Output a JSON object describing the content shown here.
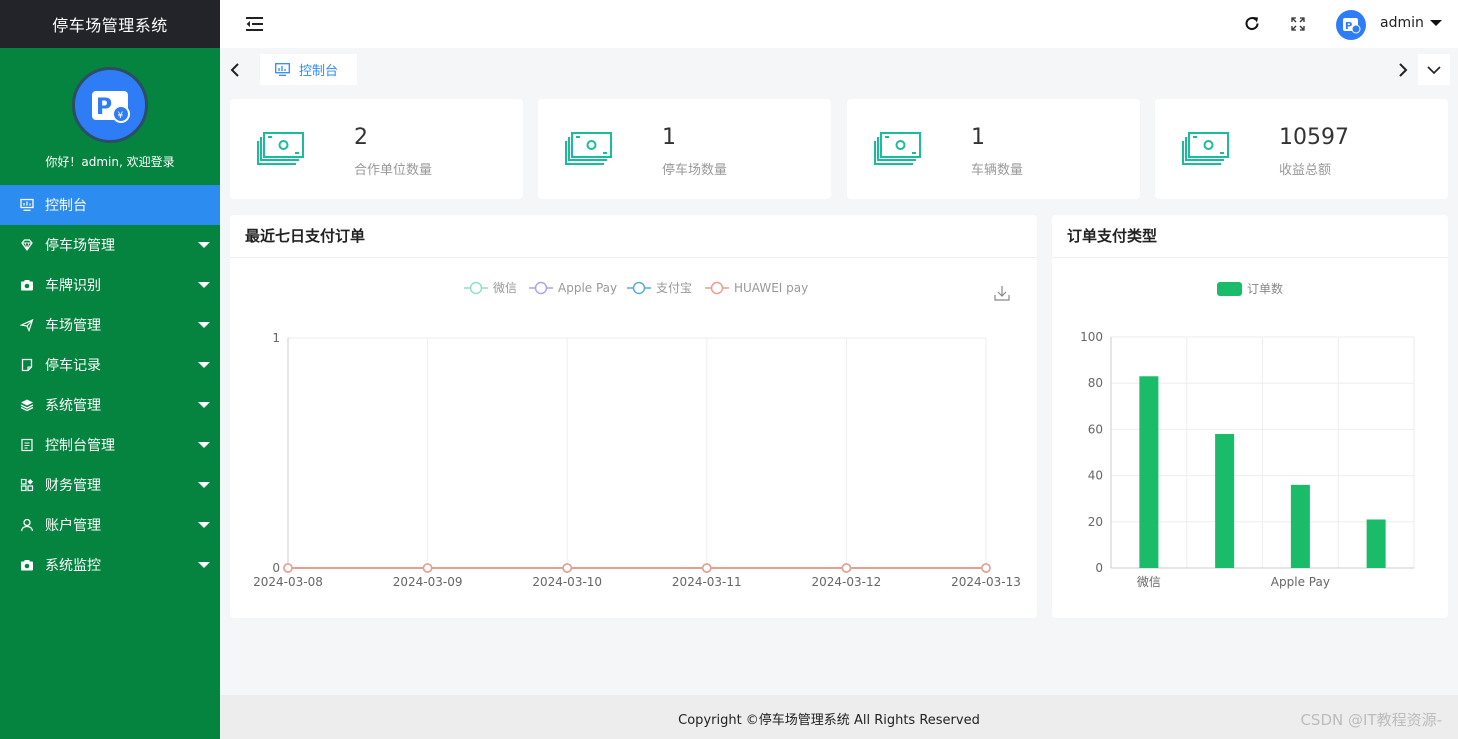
{
  "app": {
    "title": "停车场管理系统"
  },
  "sidebar": {
    "welcome": "你好！admin, 欢迎登录",
    "items": [
      {
        "label": "控制台",
        "icon": "dashboard-icon",
        "active": true,
        "has_children": false
      },
      {
        "label": "停车场管理",
        "icon": "diamond-icon",
        "has_children": true
      },
      {
        "label": "车牌识别",
        "icon": "camera-icon",
        "has_children": true
      },
      {
        "label": "车场管理",
        "icon": "send-icon",
        "has_children": true
      },
      {
        "label": "停车记录",
        "icon": "note-icon",
        "has_children": true
      },
      {
        "label": "系统管理",
        "icon": "layers-icon",
        "has_children": true
      },
      {
        "label": "控制台管理",
        "icon": "clipboard-icon",
        "has_children": true
      },
      {
        "label": "财务管理",
        "icon": "apps-icon",
        "has_children": true
      },
      {
        "label": "账户管理",
        "icon": "user-icon",
        "has_children": true
      },
      {
        "label": "系统监控",
        "icon": "camera-icon",
        "has_children": true
      }
    ]
  },
  "header": {
    "username": "admin"
  },
  "tabs": [
    {
      "label": "控制台",
      "icon": "dashboard-icon"
    }
  ],
  "stats": [
    {
      "value": "2",
      "label": "合作单位数量"
    },
    {
      "value": "1",
      "label": "停车场数量"
    },
    {
      "value": "1",
      "label": "车辆数量"
    },
    {
      "value": "10597",
      "label": "收益总额"
    }
  ],
  "colors": {
    "sidebar": "#05843f",
    "brand_bar": "#222429",
    "active": "#2d8cf0",
    "bar": "#1abc6a",
    "money_icon": "#1abc9c"
  },
  "panels": {
    "line_title": "最近七日支付订单",
    "bar_title": "订单支付类型"
  },
  "chart_data": [
    {
      "type": "line",
      "title": "最近七日支付订单",
      "x": [
        "2024-03-08",
        "2024-03-09",
        "2024-03-10",
        "2024-03-11",
        "2024-03-12",
        "2024-03-13"
      ],
      "ylim": [
        0,
        1
      ],
      "yticks": [
        0,
        1
      ],
      "legend_position": "top",
      "series": [
        {
          "name": "微信",
          "color": "#91e0c4",
          "values": [
            0,
            0,
            0,
            0,
            0,
            0
          ]
        },
        {
          "name": "Apple Pay",
          "color": "#a7a8e0",
          "values": [
            0,
            0,
            0,
            0,
            0,
            0
          ]
        },
        {
          "name": "支付宝",
          "color": "#5aacd8",
          "values": [
            0,
            0,
            0,
            0,
            0,
            0
          ]
        },
        {
          "name": "HUAWEI pay",
          "color": "#e8a08e",
          "values": [
            0,
            0,
            0,
            0,
            0,
            0
          ]
        }
      ],
      "grid": true
    },
    {
      "type": "bar",
      "title": "订单支付类型",
      "categories": [
        "微信",
        "",
        "Apple Pay",
        ""
      ],
      "ylim": [
        0,
        100
      ],
      "yticks": [
        0,
        20,
        40,
        60,
        80,
        100
      ],
      "legend_position": "top",
      "series": [
        {
          "name": "订单数",
          "color": "#1abc6a",
          "values": [
            83,
            58,
            36,
            21
          ]
        }
      ],
      "grid": true
    }
  ],
  "footer": {
    "copyright": "Copyright ©停车场管理系统 All Rights Reserved",
    "watermark": "CSDN @IT教程资源-"
  }
}
